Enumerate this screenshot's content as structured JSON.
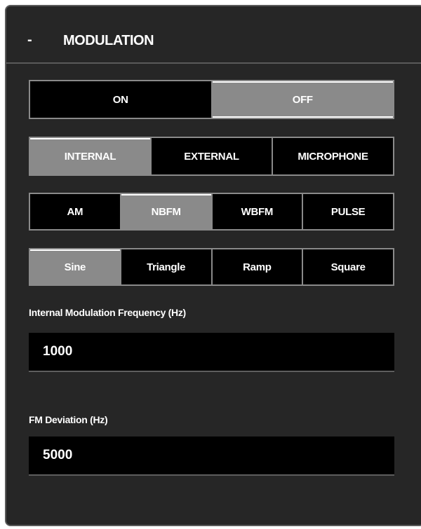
{
  "panel": {
    "collapse_symbol": "-",
    "title": "MODULATION"
  },
  "power": {
    "options": [
      "ON",
      "OFF"
    ],
    "selected": "OFF"
  },
  "source": {
    "options": [
      "INTERNAL",
      "EXTERNAL",
      "MICROPHONE"
    ],
    "selected": "INTERNAL"
  },
  "mod_type": {
    "options": [
      "AM",
      "NBFM",
      "WBFM",
      "PULSE"
    ],
    "selected": "NBFM"
  },
  "waveform": {
    "options": [
      "Sine",
      "Triangle",
      "Ramp",
      "Square"
    ],
    "selected": "Sine"
  },
  "fields": {
    "internal_freq_label": "Internal Modulation Frequency (Hz)",
    "internal_freq_value": "1000",
    "fm_deviation_label": "FM Deviation (Hz)",
    "fm_deviation_value": "5000"
  },
  "colors": {
    "panel_bg": "#262626",
    "button_bg": "#000000",
    "button_active": "#8a8a8a",
    "border": "#8a8a8a",
    "text": "#ffffff"
  }
}
